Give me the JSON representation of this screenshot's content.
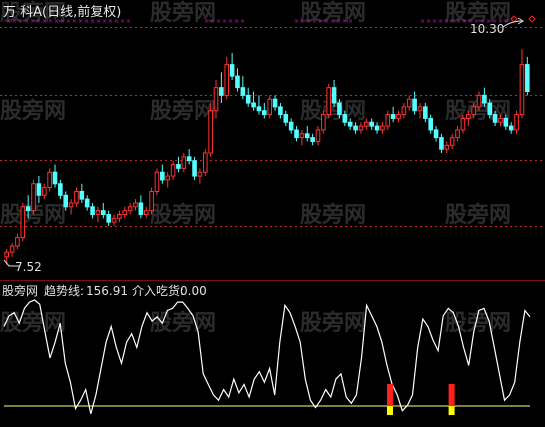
{
  "header": {
    "title": "万 科A(日线,前复权)"
  },
  "price_panel": {
    "high_label": "10.30",
    "low_label": "7.52"
  },
  "indicator_panel": {
    "watermark": "股旁网",
    "readout_name": "趋势线:",
    "readout_value": "156.91",
    "signal_name": "介入吃货:",
    "signal_value": "0.00"
  },
  "watermark_text": "股旁网",
  "colors": {
    "background": "#000000",
    "up_candle": "#FF3232",
    "down_candle": "#54FFFF",
    "grid_red": "#C0282C",
    "marker_magenta": "#E000E0",
    "trend_line": "#FFFFFF",
    "baseline": "#FFFF80",
    "signal_red": "#FF2020",
    "signal_yellow": "#FFFF00"
  },
  "chart_data": [
    {
      "type": "candlestick",
      "title": "万 科A(日线,前复权)",
      "y_max_label": 10.3,
      "y_min_label": 7.52,
      "ylim": [
        7.35,
        10.55
      ],
      "candles": [
        [
          7.6,
          7.7,
          7.5,
          7.66
        ],
        [
          7.66,
          7.78,
          7.6,
          7.74
        ],
        [
          7.74,
          7.9,
          7.7,
          7.85
        ],
        [
          7.85,
          8.3,
          7.8,
          8.25
        ],
        [
          8.25,
          8.4,
          8.1,
          8.2
        ],
        [
          8.2,
          8.6,
          8.15,
          8.55
        ],
        [
          8.55,
          8.65,
          8.3,
          8.4
        ],
        [
          8.4,
          8.55,
          8.35,
          8.5
        ],
        [
          8.5,
          8.75,
          8.45,
          8.7
        ],
        [
          8.7,
          8.8,
          8.5,
          8.55
        ],
        [
          8.55,
          8.6,
          8.35,
          8.4
        ],
        [
          8.4,
          8.45,
          8.2,
          8.25
        ],
        [
          8.25,
          8.35,
          8.15,
          8.3
        ],
        [
          8.3,
          8.5,
          8.25,
          8.45
        ],
        [
          8.45,
          8.55,
          8.3,
          8.35
        ],
        [
          8.35,
          8.4,
          8.2,
          8.25
        ],
        [
          8.25,
          8.3,
          8.1,
          8.15
        ],
        [
          8.15,
          8.25,
          8.05,
          8.2
        ],
        [
          8.2,
          8.3,
          8.1,
          8.15
        ],
        [
          8.15,
          8.2,
          8.0,
          8.05
        ],
        [
          8.05,
          8.15,
          8.0,
          8.1
        ],
        [
          8.1,
          8.2,
          8.05,
          8.15
        ],
        [
          8.15,
          8.25,
          8.1,
          8.2
        ],
        [
          8.2,
          8.3,
          8.15,
          8.25
        ],
        [
          8.25,
          8.35,
          8.2,
          8.3
        ],
        [
          8.3,
          8.4,
          8.1,
          8.15
        ],
        [
          8.15,
          8.25,
          8.1,
          8.2
        ],
        [
          8.2,
          8.5,
          8.15,
          8.45
        ],
        [
          8.45,
          8.75,
          8.4,
          8.7
        ],
        [
          8.7,
          8.8,
          8.55,
          8.6
        ],
        [
          8.6,
          8.7,
          8.5,
          8.65
        ],
        [
          8.65,
          8.85,
          8.6,
          8.8
        ],
        [
          8.8,
          8.9,
          8.7,
          8.75
        ],
        [
          8.75,
          8.95,
          8.7,
          8.9
        ],
        [
          8.9,
          9.0,
          8.8,
          8.85
        ],
        [
          8.85,
          8.9,
          8.6,
          8.65
        ],
        [
          8.65,
          8.75,
          8.55,
          8.7
        ],
        [
          8.7,
          9.0,
          8.65,
          8.95
        ],
        [
          8.95,
          9.6,
          8.9,
          9.5
        ],
        [
          9.5,
          9.9,
          9.4,
          9.8
        ],
        [
          9.8,
          10.0,
          9.6,
          9.7
        ],
        [
          9.7,
          10.2,
          9.65,
          10.1
        ],
        [
          10.1,
          10.25,
          9.9,
          9.95
        ],
        [
          9.95,
          10.05,
          9.75,
          9.8
        ],
        [
          9.8,
          9.95,
          9.65,
          9.7
        ],
        [
          9.7,
          9.8,
          9.55,
          9.6
        ],
        [
          9.6,
          9.75,
          9.5,
          9.55
        ],
        [
          9.55,
          9.7,
          9.45,
          9.5
        ],
        [
          9.5,
          9.6,
          9.4,
          9.45
        ],
        [
          9.45,
          9.7,
          9.4,
          9.65
        ],
        [
          9.65,
          9.7,
          9.5,
          9.55
        ],
        [
          9.55,
          9.6,
          9.4,
          9.45
        ],
        [
          9.45,
          9.5,
          9.3,
          9.35
        ],
        [
          9.35,
          9.4,
          9.2,
          9.25
        ],
        [
          9.25,
          9.3,
          9.1,
          9.15
        ],
        [
          9.15,
          9.25,
          9.05,
          9.2
        ],
        [
          9.2,
          9.3,
          9.1,
          9.15
        ],
        [
          9.15,
          9.2,
          9.05,
          9.1
        ],
        [
          9.1,
          9.3,
          9.05,
          9.25
        ],
        [
          9.25,
          9.5,
          9.2,
          9.45
        ],
        [
          9.45,
          9.85,
          9.4,
          9.8
        ],
        [
          9.8,
          9.9,
          9.55,
          9.6
        ],
        [
          9.6,
          9.65,
          9.4,
          9.45
        ],
        [
          9.45,
          9.5,
          9.3,
          9.35
        ],
        [
          9.35,
          9.4,
          9.25,
          9.3
        ],
        [
          9.3,
          9.35,
          9.2,
          9.25
        ],
        [
          9.25,
          9.35,
          9.2,
          9.3
        ],
        [
          9.3,
          9.4,
          9.25,
          9.35
        ],
        [
          9.35,
          9.4,
          9.25,
          9.3
        ],
        [
          9.3,
          9.35,
          9.2,
          9.25
        ],
        [
          9.25,
          9.35,
          9.2,
          9.3
        ],
        [
          9.3,
          9.5,
          9.25,
          9.45
        ],
        [
          9.45,
          9.55,
          9.35,
          9.4
        ],
        [
          9.4,
          9.5,
          9.35,
          9.45
        ],
        [
          9.45,
          9.6,
          9.4,
          9.55
        ],
        [
          9.55,
          9.7,
          9.5,
          9.65
        ],
        [
          9.65,
          9.75,
          9.45,
          9.5
        ],
        [
          9.5,
          9.6,
          9.4,
          9.55
        ],
        [
          9.55,
          9.6,
          9.35,
          9.4
        ],
        [
          9.4,
          9.45,
          9.2,
          9.25
        ],
        [
          9.25,
          9.3,
          9.1,
          9.15
        ],
        [
          9.15,
          9.2,
          8.95,
          9.0
        ],
        [
          9.0,
          9.1,
          8.95,
          9.05
        ],
        [
          9.05,
          9.2,
          9.0,
          9.15
        ],
        [
          9.15,
          9.3,
          9.1,
          9.25
        ],
        [
          9.25,
          9.45,
          9.2,
          9.4
        ],
        [
          9.4,
          9.5,
          9.3,
          9.45
        ],
        [
          9.45,
          9.6,
          9.4,
          9.55
        ],
        [
          9.55,
          9.75,
          9.5,
          9.7
        ],
        [
          9.7,
          9.8,
          9.55,
          9.6
        ],
        [
          9.6,
          9.65,
          9.4,
          9.45
        ],
        [
          9.45,
          9.5,
          9.3,
          9.35
        ],
        [
          9.35,
          9.45,
          9.3,
          9.4
        ],
        [
          9.4,
          9.45,
          9.25,
          9.3
        ],
        [
          9.3,
          9.35,
          9.2,
          9.25
        ],
        [
          9.25,
          9.5,
          9.2,
          9.45
        ],
        [
          9.45,
          10.3,
          9.4,
          10.1
        ],
        [
          10.1,
          10.2,
          9.7,
          9.75
        ]
      ]
    },
    {
      "type": "line",
      "title": "趋势线",
      "series": [
        {
          "name": "趋势线",
          "values": [
            75,
            85,
            88,
            78,
            92,
            98,
            100,
            96,
            70,
            45,
            60,
            78,
            40,
            22,
            -3,
            5,
            15,
            -8,
            10,
            35,
            60,
            75,
            55,
            40,
            60,
            68,
            55,
            75,
            88,
            80,
            84,
            78,
            90,
            92,
            98,
            98,
            92,
            85,
            70,
            30,
            20,
            10,
            5,
            15,
            8,
            25,
            12,
            20,
            8,
            25,
            32,
            22,
            35,
            10,
            60,
            95,
            88,
            75,
            60,
            25,
            5,
            -2,
            5,
            15,
            8,
            25,
            30,
            8,
            2,
            10,
            45,
            95,
            85,
            75,
            60,
            38,
            20,
            10,
            -5,
            0,
            10,
            55,
            82,
            75,
            62,
            52,
            85,
            92,
            88,
            75,
            55,
            38,
            70,
            90,
            92,
            80,
            55,
            30,
            5,
            10,
            22,
            60,
            90,
            84
          ]
        },
        {
          "name": "介入吃货",
          "value": 0.0
        }
      ],
      "baseline": 0,
      "signal_bars_at_index": [
        38,
        49
      ]
    }
  ]
}
